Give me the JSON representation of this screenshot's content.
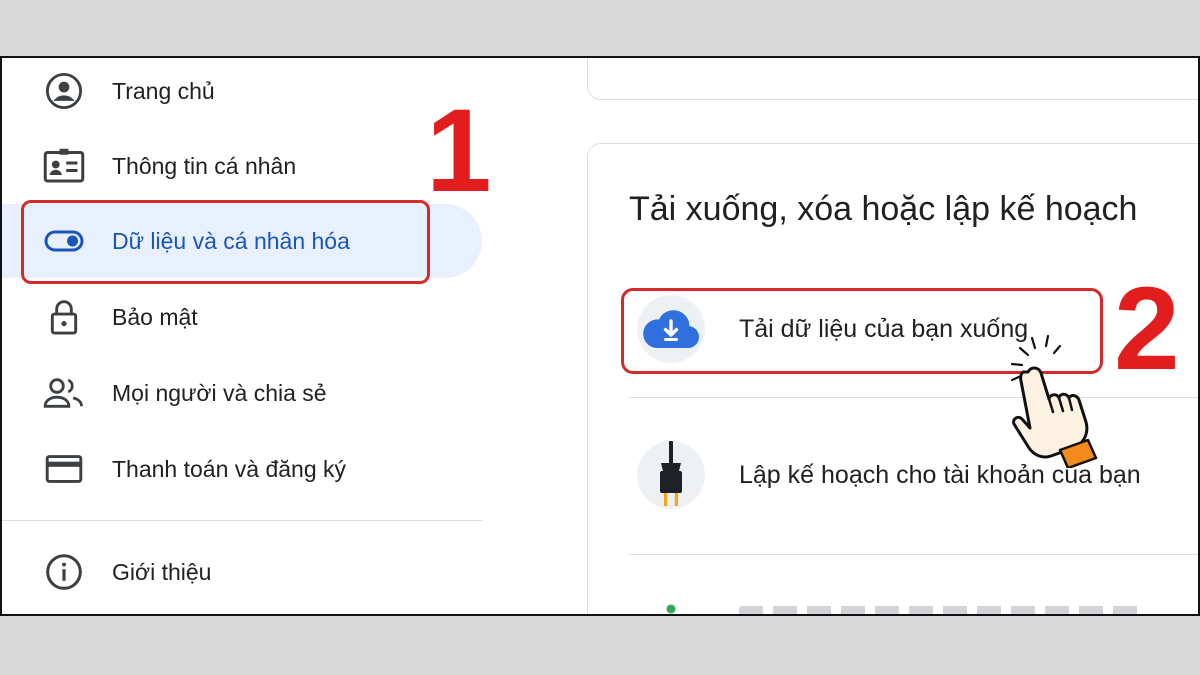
{
  "sidebar": {
    "items": [
      {
        "label": "Trang chủ",
        "icon": "account-circle-icon"
      },
      {
        "label": "Thông tin cá nhân",
        "icon": "id-card-icon"
      },
      {
        "label": "Dữ liệu và cá nhân hóa",
        "icon": "toggle-icon",
        "active": true
      },
      {
        "label": "Bảo mật",
        "icon": "lock-icon"
      },
      {
        "label": "Mọi người và chia sẻ",
        "icon": "people-icon"
      },
      {
        "label": "Thanh toán và đăng ký",
        "icon": "credit-card-icon"
      }
    ],
    "about": {
      "label": "Giới thiệu",
      "icon": "info-icon"
    }
  },
  "main": {
    "section_title": "Tải xuống, xóa hoặc lập kế hoạch",
    "rows": [
      {
        "label": "Tải dữ liệu của bạn xuống",
        "icon": "cloud-download-icon"
      },
      {
        "label": "Lập kế hoạch cho tài khoản của bạn",
        "icon": "power-plug-icon"
      }
    ]
  },
  "annotations": {
    "step1": "1",
    "step2": "2",
    "highlight_color": "#d32a2a"
  },
  "colors": {
    "active_bg": "#e8f0fe",
    "active_text": "#1a56b8",
    "accent_blue": "#2f6fde"
  }
}
